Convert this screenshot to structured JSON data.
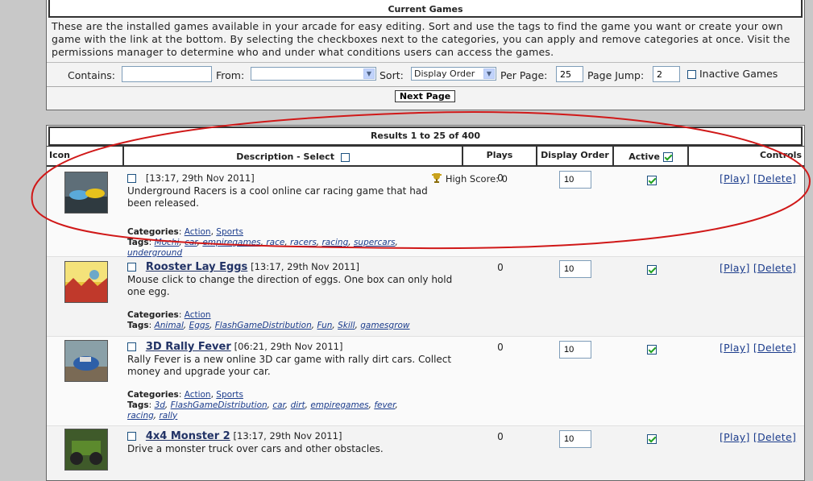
{
  "current": {
    "title": "Current Games",
    "intro": "These are the installed games available in your arcade for easy editing. Sort and use the tags to find the game you want or create your own game with the link at the bottom. By selecting the checkboxes next to the categories, you can apply and remove categories at once. Visit the permissions manager to determine who and under what conditions users can access the games.",
    "contains_label": "Contains:",
    "contains_value": "",
    "from_label": "From:",
    "from_value": "",
    "sort_label": "Sort:",
    "sort_value": "Display Order",
    "perpage_label": "Per Page:",
    "perpage_value": "25",
    "jump_label": "Page Jump:",
    "jump_value": "2",
    "inactive_label": "Inactive Games",
    "next_label": "Next Page"
  },
  "results": {
    "title": "Results 1 to 25 of 400",
    "col_icon": "Icon",
    "col_desc": "Description - Select",
    "col_plays": "Plays",
    "col_order": "Display Order",
    "col_active": "Active",
    "col_controls": "Controls"
  },
  "labels": {
    "categories": "Categories",
    "tags": "Tags",
    "play": "[Play]",
    "delete": "[Delete]",
    "highscore": "High Score: 0"
  },
  "games": [
    {
      "title": "",
      "date": "[13:17, 29th Nov 2011]",
      "desc": "Underground Racers is a cool online car racing game that had been released.",
      "plays": "0",
      "order": "10",
      "categories": [
        "Action",
        "Sports"
      ],
      "tags": [
        "Mochi",
        "car",
        "empiregames",
        "race",
        "racers",
        "racing",
        "supercars",
        "underground"
      ]
    },
    {
      "title": "Rooster Lay Eggs",
      "date": "[13:17, 29th Nov 2011]",
      "desc": "Mouse click to change the direction of eggs. One box can only hold one egg.",
      "plays": "0",
      "order": "10",
      "categories": [
        "Action"
      ],
      "tags": [
        "Animal",
        "Eggs",
        "FlashGameDistribution",
        "Fun",
        "Skill",
        "gamesgrow"
      ]
    },
    {
      "title": "3D Rally Fever",
      "date": "[06:21, 29th Nov 2011]",
      "desc": "Rally Fever is a new online 3D car game with rally dirt cars. Collect money and upgrade your car.",
      "plays": "0",
      "order": "10",
      "categories": [
        "Action",
        "Sports"
      ],
      "tags": [
        "3d",
        "FlashGameDistribution",
        "car",
        "dirt",
        "empiregames",
        "fever",
        "racing",
        "rally"
      ]
    },
    {
      "title": "4x4 Monster 2",
      "date": "[13:17, 29th Nov 2011]",
      "desc": "Drive a monster truck over cars and other obstacles.",
      "plays": "0",
      "order": "10",
      "categories": [],
      "tags": []
    }
  ],
  "colors": {
    "annotation": "#d01818",
    "link": "#1b3c8c"
  },
  "icons": [
    "trophy-icon",
    "checkbox-icon",
    "dropdown-arrow-icon"
  ]
}
